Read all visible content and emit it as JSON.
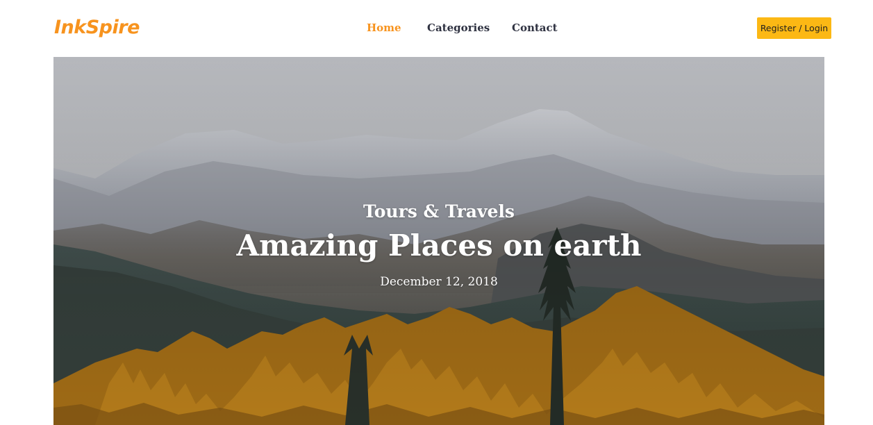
{
  "brand": {
    "logo_text": "InkSpire",
    "accent_color": "#f7931e"
  },
  "nav": {
    "items": [
      {
        "label": "Home",
        "active": true
      },
      {
        "label": "Categories",
        "active": false
      },
      {
        "label": "Contact",
        "active": false
      }
    ]
  },
  "header": {
    "auth_label": "Register / Login",
    "auth_color": "#fcb814"
  },
  "hero": {
    "image": "mountain-forest-landscape",
    "category": "Tours & Travels",
    "title": "Amazing Places on earth",
    "date": "December 12, 2018"
  }
}
